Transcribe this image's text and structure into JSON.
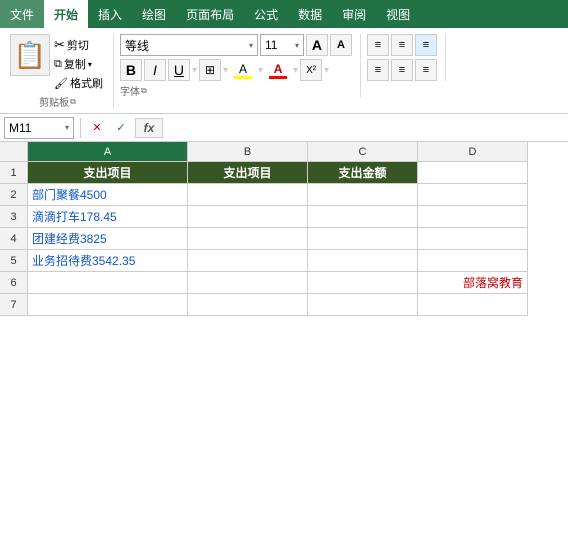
{
  "menubar": {
    "items": [
      "文件",
      "开始",
      "插入",
      "绘图",
      "页面布局",
      "公式",
      "数据",
      "审阅",
      "视图"
    ],
    "active": "开始"
  },
  "ribbon": {
    "paste_label": "粘贴",
    "clipboard_label": "剪贴板",
    "font_name": "等线",
    "font_size": "11",
    "bold": "B",
    "italic": "I",
    "underline": "U",
    "font_label": "字体",
    "highlight_color": "#FFFF00",
    "font_color": "#FF0000",
    "grow_icon": "A",
    "shrink_icon": "A"
  },
  "formula_bar": {
    "cell_ref": "M11",
    "cancel_btn": "✕",
    "confirm_btn": "✓",
    "fx_label": "fx",
    "formula_value": ""
  },
  "spreadsheet": {
    "col_headers": [
      "A",
      "B",
      "C",
      "D"
    ],
    "row_headers": [
      "1",
      "2",
      "3",
      "4",
      "5",
      "6",
      "7"
    ],
    "rows": [
      [
        {
          "text": "支出项目",
          "type": "header"
        },
        {
          "text": "支出项目",
          "type": "header"
        },
        {
          "text": "支出金额",
          "type": "header"
        },
        {
          "text": "",
          "type": "normal"
        }
      ],
      [
        {
          "text": "部门聚餐4500",
          "type": "data"
        },
        {
          "text": "",
          "type": "normal"
        },
        {
          "text": "",
          "type": "normal"
        },
        {
          "text": "",
          "type": "normal"
        }
      ],
      [
        {
          "text": "滴滴打车178.45",
          "type": "data"
        },
        {
          "text": "",
          "type": "normal"
        },
        {
          "text": "",
          "type": "normal"
        },
        {
          "text": "",
          "type": "normal"
        }
      ],
      [
        {
          "text": "团建经费3825",
          "type": "data"
        },
        {
          "text": "",
          "type": "normal"
        },
        {
          "text": "",
          "type": "normal"
        },
        {
          "text": "",
          "type": "normal"
        }
      ],
      [
        {
          "text": "业务招待费3542.35",
          "type": "data"
        },
        {
          "text": "",
          "type": "normal"
        },
        {
          "text": "",
          "type": "normal"
        },
        {
          "text": "",
          "type": "normal"
        }
      ],
      [
        {
          "text": "",
          "type": "normal"
        },
        {
          "text": "",
          "type": "normal"
        },
        {
          "text": "",
          "type": "normal"
        },
        {
          "text": "部落窝教育",
          "type": "brand"
        }
      ],
      [
        {
          "text": "",
          "type": "normal"
        },
        {
          "text": "",
          "type": "normal"
        },
        {
          "text": "",
          "type": "normal"
        },
        {
          "text": "",
          "type": "normal"
        }
      ]
    ]
  }
}
